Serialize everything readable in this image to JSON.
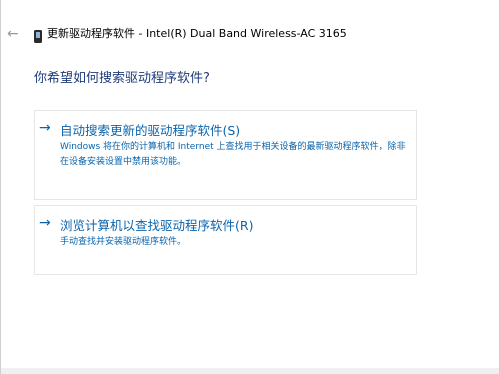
{
  "window": {
    "title": "更新驱动程序软件 - Intel(R) Dual Band Wireless-AC 3165"
  },
  "icons": {
    "back": "back-arrow-icon",
    "device": "device-icon",
    "close": "close-icon",
    "option_arrow": "right-arrow-icon"
  },
  "heading": "你希望如何搜索驱动程序软件?",
  "options": [
    {
      "title": "自动搜索更新的驱动程序软件(S)",
      "description": "Windows 将在你的计算机和 Internet 上查找用于相关设备的最新驱动程序软件，除非在设备安装设置中禁用该功能。"
    },
    {
      "title": "浏览计算机以查找驱动程序软件(R)",
      "description": "手动查找并安装驱动程序软件。"
    }
  ],
  "colors": {
    "accent": "#0a64ad",
    "heading": "#1f3d7a"
  }
}
